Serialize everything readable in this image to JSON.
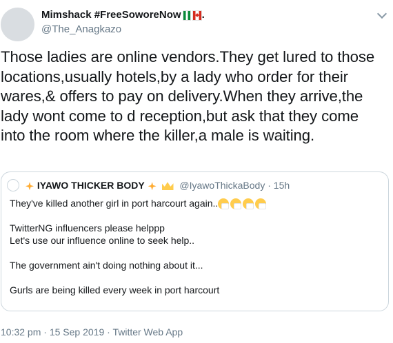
{
  "tweet": {
    "author_name": "Mimshack #FreeSoworeNow",
    "author_suffix": ".",
    "author_flags": [
      "flag-nigeria-icon",
      "flag-canada-icon"
    ],
    "author_handle": "@The_Anagkazo",
    "text_lines": [
      "Those ladies are online vendors.They get lured to those",
      "locations,usually hotels,by a lady who order for their",
      "wares,& offers to pay on delivery.When they arrive,the",
      "lady wont come to d reception,but ask that they come",
      "into the room where the killer,a male is waiting."
    ]
  },
  "quoted_tweet": {
    "author_name": "IYAWO THICKER BODY",
    "author_handle": "@IyawoThickaBody",
    "separator": " · ",
    "time_ago": "15h",
    "name_emojis": [
      "sparkles-icon",
      "sparkles-icon",
      "crown-icon"
    ],
    "line1": "They've killed another girl in port harcourt again..",
    "line1_emojis": [
      "sneezing-face-icon",
      "sneezing-face-icon",
      "sneezing-face-icon",
      "sneezing-face-icon"
    ],
    "line2": "TwitterNG influencers please helppp",
    "line3": "Let's use our influence online to seek help..",
    "line4": "The government ain't doing nothing about it...",
    "line5": "Gurls are being killed every week in port harcourt"
  },
  "meta": {
    "time": "10:32 pm",
    "date": "15 Sep 2019",
    "separator": " · ",
    "source": "Twitter Web App"
  },
  "colors": {
    "text": "#14171a",
    "secondary": "#657786",
    "border": "#ccd6dd",
    "link": "#1da1f2"
  }
}
